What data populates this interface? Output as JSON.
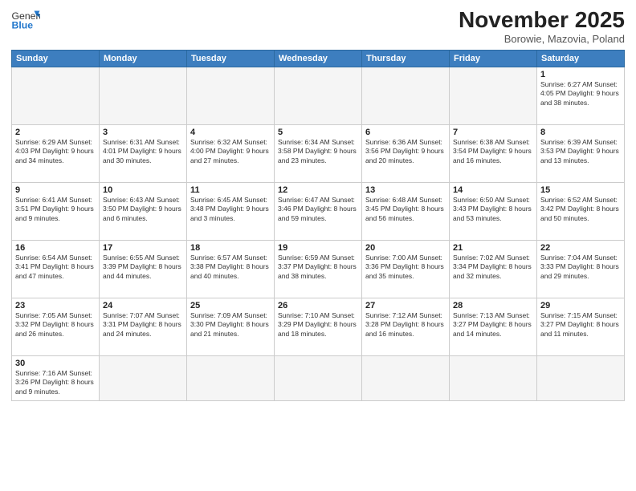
{
  "header": {
    "logo_general": "General",
    "logo_blue": "Blue",
    "month_title": "November 2025",
    "subtitle": "Borowie, Mazovia, Poland"
  },
  "days_of_week": [
    "Sunday",
    "Monday",
    "Tuesday",
    "Wednesday",
    "Thursday",
    "Friday",
    "Saturday"
  ],
  "weeks": [
    [
      {
        "day": "",
        "info": ""
      },
      {
        "day": "",
        "info": ""
      },
      {
        "day": "",
        "info": ""
      },
      {
        "day": "",
        "info": ""
      },
      {
        "day": "",
        "info": ""
      },
      {
        "day": "",
        "info": ""
      },
      {
        "day": "1",
        "info": "Sunrise: 6:27 AM\nSunset: 4:05 PM\nDaylight: 9 hours\nand 38 minutes."
      }
    ],
    [
      {
        "day": "2",
        "info": "Sunrise: 6:29 AM\nSunset: 4:03 PM\nDaylight: 9 hours\nand 34 minutes."
      },
      {
        "day": "3",
        "info": "Sunrise: 6:31 AM\nSunset: 4:01 PM\nDaylight: 9 hours\nand 30 minutes."
      },
      {
        "day": "4",
        "info": "Sunrise: 6:32 AM\nSunset: 4:00 PM\nDaylight: 9 hours\nand 27 minutes."
      },
      {
        "day": "5",
        "info": "Sunrise: 6:34 AM\nSunset: 3:58 PM\nDaylight: 9 hours\nand 23 minutes."
      },
      {
        "day": "6",
        "info": "Sunrise: 6:36 AM\nSunset: 3:56 PM\nDaylight: 9 hours\nand 20 minutes."
      },
      {
        "day": "7",
        "info": "Sunrise: 6:38 AM\nSunset: 3:54 PM\nDaylight: 9 hours\nand 16 minutes."
      },
      {
        "day": "8",
        "info": "Sunrise: 6:39 AM\nSunset: 3:53 PM\nDaylight: 9 hours\nand 13 minutes."
      }
    ],
    [
      {
        "day": "9",
        "info": "Sunrise: 6:41 AM\nSunset: 3:51 PM\nDaylight: 9 hours\nand 9 minutes."
      },
      {
        "day": "10",
        "info": "Sunrise: 6:43 AM\nSunset: 3:50 PM\nDaylight: 9 hours\nand 6 minutes."
      },
      {
        "day": "11",
        "info": "Sunrise: 6:45 AM\nSunset: 3:48 PM\nDaylight: 9 hours\nand 3 minutes."
      },
      {
        "day": "12",
        "info": "Sunrise: 6:47 AM\nSunset: 3:46 PM\nDaylight: 8 hours\nand 59 minutes."
      },
      {
        "day": "13",
        "info": "Sunrise: 6:48 AM\nSunset: 3:45 PM\nDaylight: 8 hours\nand 56 minutes."
      },
      {
        "day": "14",
        "info": "Sunrise: 6:50 AM\nSunset: 3:43 PM\nDaylight: 8 hours\nand 53 minutes."
      },
      {
        "day": "15",
        "info": "Sunrise: 6:52 AM\nSunset: 3:42 PM\nDaylight: 8 hours\nand 50 minutes."
      }
    ],
    [
      {
        "day": "16",
        "info": "Sunrise: 6:54 AM\nSunset: 3:41 PM\nDaylight: 8 hours\nand 47 minutes."
      },
      {
        "day": "17",
        "info": "Sunrise: 6:55 AM\nSunset: 3:39 PM\nDaylight: 8 hours\nand 44 minutes."
      },
      {
        "day": "18",
        "info": "Sunrise: 6:57 AM\nSunset: 3:38 PM\nDaylight: 8 hours\nand 40 minutes."
      },
      {
        "day": "19",
        "info": "Sunrise: 6:59 AM\nSunset: 3:37 PM\nDaylight: 8 hours\nand 38 minutes."
      },
      {
        "day": "20",
        "info": "Sunrise: 7:00 AM\nSunset: 3:36 PM\nDaylight: 8 hours\nand 35 minutes."
      },
      {
        "day": "21",
        "info": "Sunrise: 7:02 AM\nSunset: 3:34 PM\nDaylight: 8 hours\nand 32 minutes."
      },
      {
        "day": "22",
        "info": "Sunrise: 7:04 AM\nSunset: 3:33 PM\nDaylight: 8 hours\nand 29 minutes."
      }
    ],
    [
      {
        "day": "23",
        "info": "Sunrise: 7:05 AM\nSunset: 3:32 PM\nDaylight: 8 hours\nand 26 minutes."
      },
      {
        "day": "24",
        "info": "Sunrise: 7:07 AM\nSunset: 3:31 PM\nDaylight: 8 hours\nand 24 minutes."
      },
      {
        "day": "25",
        "info": "Sunrise: 7:09 AM\nSunset: 3:30 PM\nDaylight: 8 hours\nand 21 minutes."
      },
      {
        "day": "26",
        "info": "Sunrise: 7:10 AM\nSunset: 3:29 PM\nDaylight: 8 hours\nand 18 minutes."
      },
      {
        "day": "27",
        "info": "Sunrise: 7:12 AM\nSunset: 3:28 PM\nDaylight: 8 hours\nand 16 minutes."
      },
      {
        "day": "28",
        "info": "Sunrise: 7:13 AM\nSunset: 3:27 PM\nDaylight: 8 hours\nand 14 minutes."
      },
      {
        "day": "29",
        "info": "Sunrise: 7:15 AM\nSunset: 3:27 PM\nDaylight: 8 hours\nand 11 minutes."
      }
    ],
    [
      {
        "day": "30",
        "info": "Sunrise: 7:16 AM\nSunset: 3:26 PM\nDaylight: 8 hours\nand 9 minutes."
      },
      {
        "day": "",
        "info": ""
      },
      {
        "day": "",
        "info": ""
      },
      {
        "day": "",
        "info": ""
      },
      {
        "day": "",
        "info": ""
      },
      {
        "day": "",
        "info": ""
      },
      {
        "day": "",
        "info": ""
      }
    ]
  ]
}
